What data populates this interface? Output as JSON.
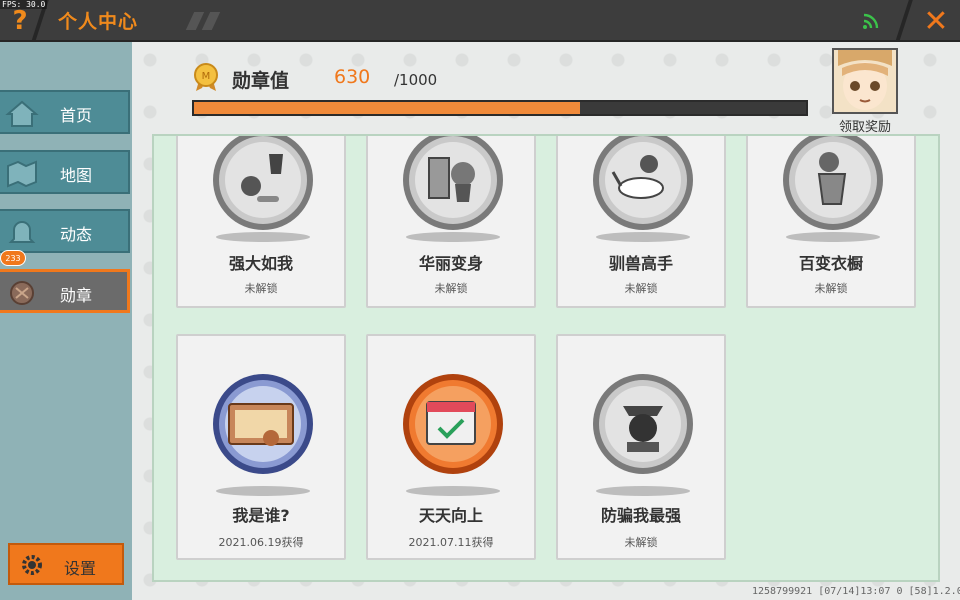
{
  "fps": "FPS: 30.0",
  "header": {
    "help_glyph": "?",
    "title": "个人中心",
    "close_glyph": "✕"
  },
  "sidebar": {
    "items": [
      {
        "label": "首页",
        "icon": "house-icon",
        "active": false
      },
      {
        "label": "地图",
        "icon": "map-icon",
        "active": false
      },
      {
        "label": "动态",
        "icon": "bell-icon",
        "active": false
      },
      {
        "label": "勋章",
        "icon": "medal-nav-icon",
        "active": true
      }
    ],
    "badge": "233",
    "settings_label": "设置"
  },
  "medal_score": {
    "label": "勋章值",
    "value": "630",
    "max": "/1000",
    "progress": 0.63
  },
  "reward": {
    "label": "领取奖励"
  },
  "badges": [
    {
      "name": "强大如我",
      "status": "未解锁",
      "unlocked": false,
      "icon": "strength-badge-icon"
    },
    {
      "name": "华丽变身",
      "status": "未解锁",
      "unlocked": false,
      "icon": "transform-badge-icon"
    },
    {
      "name": "驯兽高手",
      "status": "未解锁",
      "unlocked": false,
      "icon": "tamer-badge-icon"
    },
    {
      "name": "百变衣橱",
      "status": "未解锁",
      "unlocked": false,
      "icon": "wardrobe-badge-icon"
    },
    {
      "name": "我是谁?",
      "status": "2021.06.19获得",
      "unlocked": true,
      "icon": "id-card-badge-icon"
    },
    {
      "name": "天天向上",
      "status": "2021.07.11获得",
      "unlocked": true,
      "icon": "calendar-badge-icon"
    },
    {
      "name": "防骗我最强",
      "status": "未解锁",
      "unlocked": false,
      "icon": "police-badge-icon"
    }
  ],
  "footer": "1258799921  [07/14]13:07 0  [58]1.2.0",
  "colors": {
    "accent": "#f0781c",
    "nav": "#4e8c96",
    "grid_bg": "#d9efdf"
  }
}
